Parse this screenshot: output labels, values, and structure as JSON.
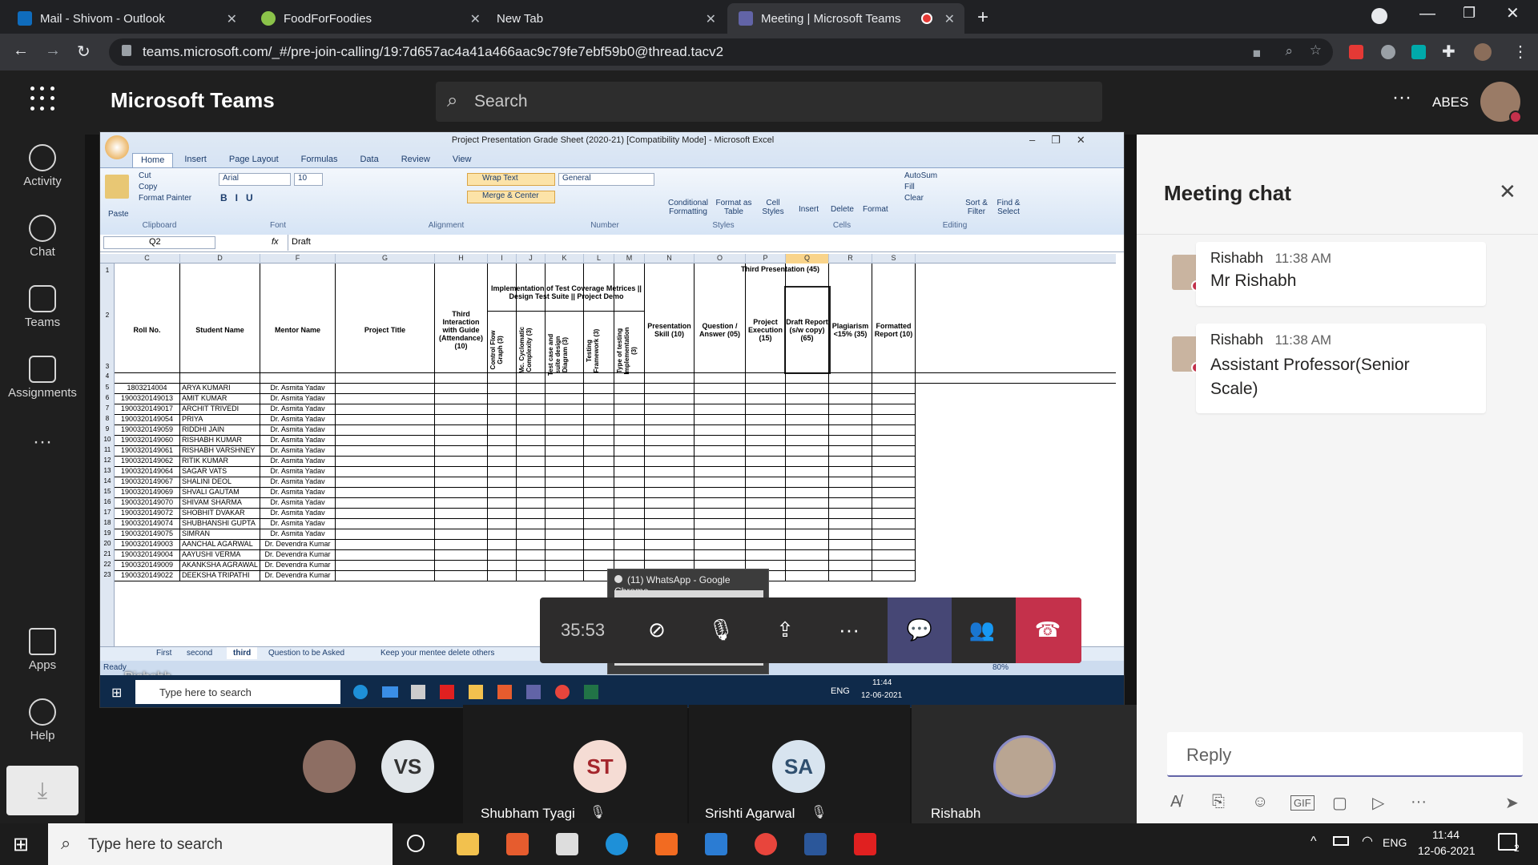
{
  "browser": {
    "tabs": [
      {
        "label": "Mail - Shivom - Outlook"
      },
      {
        "label": "FoodForFoodies"
      },
      {
        "label": "New Tab"
      },
      {
        "label": "Meeting | Microsoft Teams"
      }
    ],
    "url": "teams.microsoft.com/_#/pre-join-calling/19:7d657ac4a41a466aac9c79fe7ebf59b0@thread.tacv2"
  },
  "teams": {
    "app_title": "Microsoft Teams",
    "search_placeholder": "Search",
    "org": "ABES",
    "rail": [
      "Activity",
      "Chat",
      "Teams",
      "Assignments",
      "Apps",
      "Help"
    ]
  },
  "excel": {
    "title": "Project Presentation Grade Sheet (2020-21)  [Compatibility Mode] - Microsoft Excel",
    "ribbon_tabs": [
      "Home",
      "Insert",
      "Page Layout",
      "Formulas",
      "Data",
      "Review",
      "View"
    ],
    "font": "Arial",
    "font_size": "10",
    "number_format": "General",
    "cell_ref": "Q2",
    "formula": "Draft",
    "groups": [
      "Clipboard",
      "Font",
      "Alignment",
      "Number",
      "Styles",
      "Cells",
      "Editing"
    ],
    "clipboard": [
      "Cut",
      "Copy",
      "Format Painter",
      "Paste"
    ],
    "alignment_btns": [
      "Wrap Text",
      "Merge & Center"
    ],
    "styles": [
      "Conditional Formatting",
      "Format as Table",
      "Cell Styles"
    ],
    "cells": [
      "Insert",
      "Delete",
      "Format"
    ],
    "editing": [
      "AutoSum",
      "Fill",
      "Clear",
      "Sort & Filter",
      "Find & Select"
    ],
    "cols": [
      "C",
      "D",
      "F",
      "G",
      "H",
      "I",
      "J",
      "K",
      "L",
      "M",
      "N",
      "O",
      "P",
      "Q",
      "R",
      "S"
    ],
    "headers": {
      "roll": "Roll No.",
      "name": "Student Name",
      "mentor": "Mentor Name",
      "project": "Project Title",
      "third_interaction": "Third Interaction with Guide (Attendance) (10)",
      "impl": "Implementation of Test Coverage Metrices || Design Test Suite || Project Demo",
      "third_pres": "Third Presentation (45)",
      "n": "Presentation Skill (10)",
      "o": "Question / Answer (05)",
      "p": "Project Execution (15)",
      "q": "Draft Report (s/w copy) (65)",
      "r": "Plagiarism <15% (35)",
      "s": "Formatted Report (10)",
      "vert": [
        "Control Flow Graph (3)",
        "Mc. Cyclomatic Complexity (3)",
        "Test case and suite design Diagram (3)",
        "Testing Framework (3)",
        "Type of testing Implementation (3)"
      ]
    },
    "rows": [
      [
        "5",
        "1803214004",
        "ARYA KUMARI",
        "Dr. Asmita Yadav"
      ],
      [
        "6",
        "1900320149013",
        "AMIT KUMAR",
        "Dr. Asmita Yadav"
      ],
      [
        "7",
        "1900320149017",
        "ARCHIT TRIVEDI",
        "Dr. Asmita Yadav"
      ],
      [
        "8",
        "1900320149054",
        "PRIYA",
        "Dr. Asmita Yadav"
      ],
      [
        "9",
        "1900320149059",
        "RIDDHI JAIN",
        "Dr. Asmita Yadav"
      ],
      [
        "10",
        "1900320149060",
        "RISHABH KUMAR",
        "Dr. Asmita Yadav"
      ],
      [
        "11",
        "1900320149061",
        "RISHABH VARSHNEY",
        "Dr. Asmita Yadav"
      ],
      [
        "12",
        "1900320149062",
        "RITIK KUMAR",
        "Dr. Asmita Yadav"
      ],
      [
        "13",
        "1900320149064",
        "SAGAR VATS",
        "Dr. Asmita Yadav"
      ],
      [
        "14",
        "1900320149067",
        "SHALINI DEOL",
        "Dr. Asmita Yadav"
      ],
      [
        "15",
        "1900320149069",
        "SHVALI GAUTAM",
        "Dr. Asmita Yadav"
      ],
      [
        "16",
        "1900320149070",
        "SHIVAM SHARMA",
        "Dr. Asmita Yadav"
      ],
      [
        "17",
        "1900320149072",
        "SHOBHIT DVAKAR",
        "Dr. Asmita Yadav"
      ],
      [
        "18",
        "1900320149074",
        "SHUBHANSHI GUPTA",
        "Dr. Asmita Yadav"
      ],
      [
        "19",
        "1900320149075",
        "SIMRAN",
        "Dr. Asmita Yadav"
      ],
      [
        "20",
        "1900320149003",
        "AANCHAL AGARWAL",
        "Dr. Devendra Kumar"
      ],
      [
        "21",
        "1900320149004",
        "AAYUSHI VERMA",
        "Dr. Devendra Kumar"
      ],
      [
        "22",
        "1900320149009",
        "AKANKSHA AGRAWAL",
        "Dr. Devendra Kumar"
      ],
      [
        "23",
        "1900320149022",
        "DEEKSHA TRIPATHI",
        "Dr. Devendra Kumar"
      ]
    ],
    "sheets": [
      "First",
      "second",
      "third",
      "Question to be Asked",
      "Keep your mentee delete others"
    ],
    "status": "Ready",
    "zoom": "80%",
    "presenter": "Rishabh",
    "inner_search": "Type here to search",
    "inner_time": "11:44",
    "inner_date": "12-06-2021",
    "inner_lang": "ENG"
  },
  "popup": "(11) WhatsApp - Google Chrome",
  "meeting": {
    "timer": "35:53",
    "participants": [
      {
        "initials": "",
        "name": ""
      },
      {
        "initials": "VS",
        "name": ""
      },
      {
        "initials": "ST",
        "name": "Shubham Tyagi"
      },
      {
        "initials": "SA",
        "name": "Srishti Agarwal"
      },
      {
        "initials": "",
        "name": "Rishabh"
      }
    ]
  },
  "chat": {
    "title": "Meeting chat",
    "messages": [
      {
        "sender": "Rishabh",
        "time": "11:38 AM",
        "text": "Mr Rishabh"
      },
      {
        "sender": "Rishabh",
        "time": "11:38 AM",
        "text": "Assistant Professor(Senior Scale)"
      }
    ],
    "reply_placeholder": "Reply"
  },
  "taskbar": {
    "search": "Type here to search",
    "lang": "ENG",
    "time": "11:44",
    "date": "12-06-2021",
    "notif": "2"
  }
}
